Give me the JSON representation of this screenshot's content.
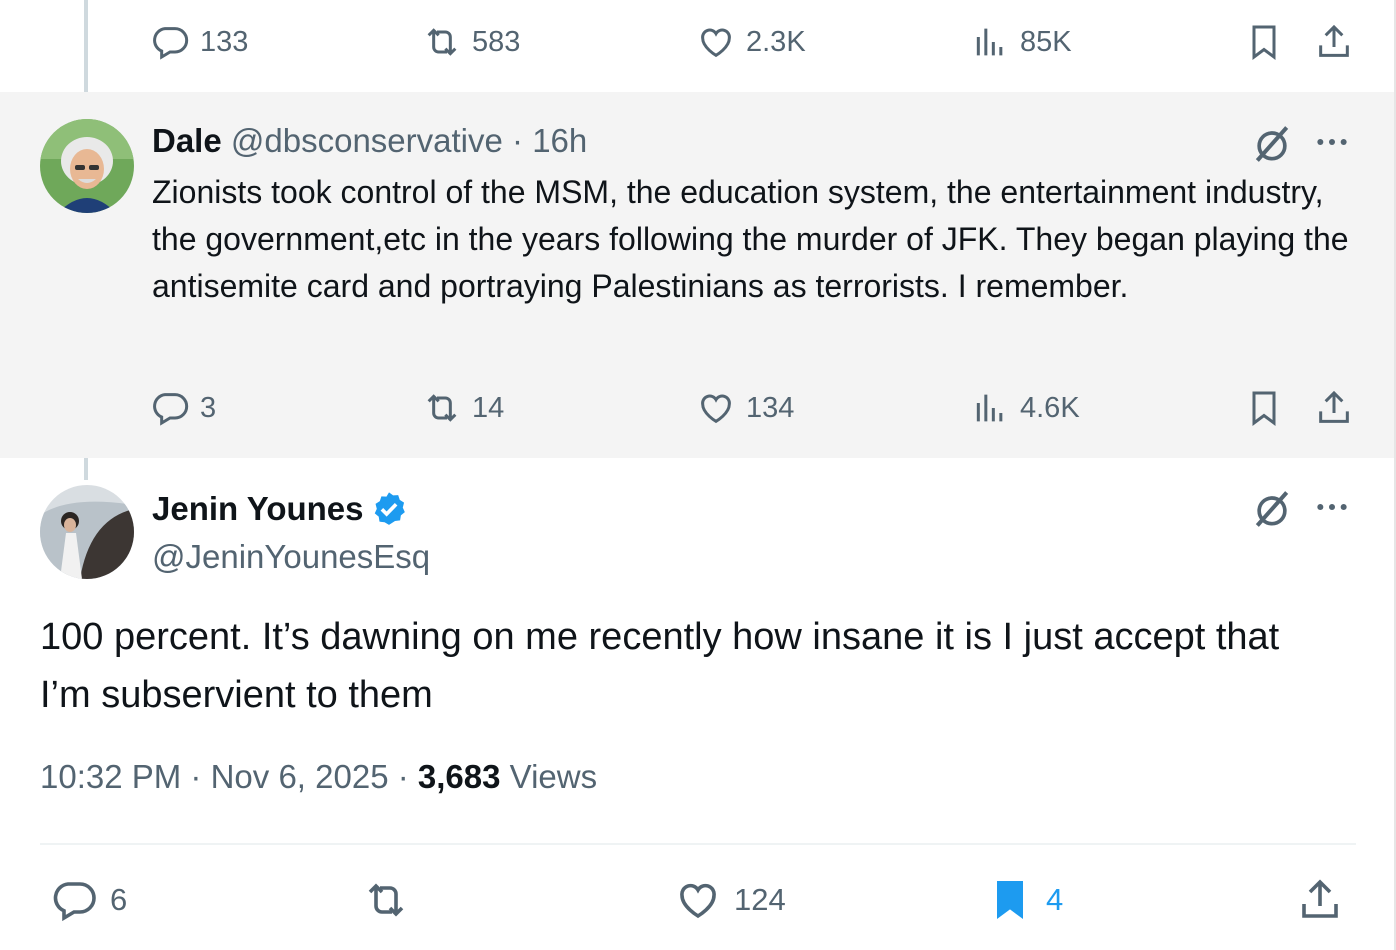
{
  "top_post_actions": {
    "replies": "133",
    "reposts": "583",
    "likes": "2.3K",
    "views": "85K"
  },
  "reply_post": {
    "author_name": "Dale",
    "author_handle": "@dbsconservative",
    "separator": "·",
    "time": "16h",
    "text": "Zionists took control of the MSM, the education system, the entertainment industry, the government,etc in the years following the murder of JFK. They began playing the antisemite card and portraying Palestinians as terrorists. I remember.",
    "replies": "3",
    "reposts": "14",
    "likes": "134",
    "views": "4.6K"
  },
  "main_post": {
    "author_name": "Jenin Younes",
    "author_handle": "@JeninYounesEsq",
    "verified": true,
    "text": "100 percent. It’s dawning on me recently how insane it is I just accept that I’m subservient to them",
    "time": "10:32 PM",
    "date": "Nov 6, 2025",
    "sep1": "·",
    "sep2": "·",
    "views_count": "3,683",
    "views_label": "Views",
    "replies": "6",
    "likes": "124",
    "bookmarks": "4"
  },
  "colors": {
    "muted": "#536471",
    "accent": "#1d9bf0",
    "thread_line": "#cfd9de",
    "highlight_bg": "#f4f4f4"
  },
  "icons": [
    "reply-icon",
    "repost-icon",
    "like-icon",
    "views-icon",
    "bookmark-icon",
    "share-icon",
    "grok-icon",
    "more-icon",
    "verified-badge-icon"
  ]
}
